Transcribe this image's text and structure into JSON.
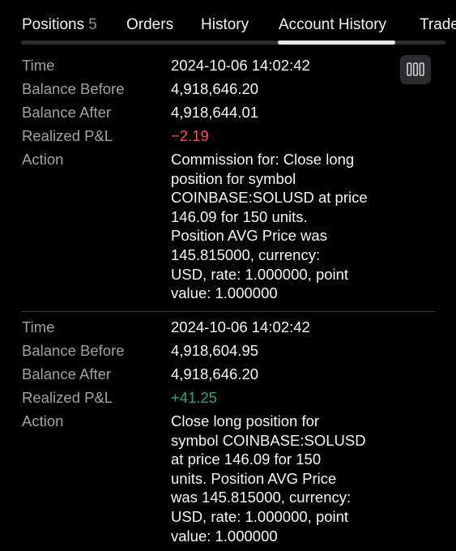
{
  "tabs": [
    {
      "label": "Positions",
      "count": "5"
    },
    {
      "label": "Orders"
    },
    {
      "label": "History"
    },
    {
      "label": "Account History",
      "active": true
    },
    {
      "label": "Trade"
    }
  ],
  "records": [
    {
      "time_label": "Time",
      "time": "2024-10-06 14:02:42",
      "balance_before_label": "Balance Before",
      "balance_before": "4,918,646.20",
      "balance_after_label": "Balance After",
      "balance_after": "4,918,644.01",
      "pnl_label": "Realized P&L",
      "pnl": "−2.19",
      "action_label": "Action",
      "action_lines": [
        "Commission for: Close long",
        "position for symbol",
        "COINBASE:SOLUSD at price",
        "146.09 for 150 units.",
        "Position AVG Price was",
        "145.815000, currency:",
        "USD, rate: 1.000000, point",
        "value: 1.000000"
      ]
    },
    {
      "time_label": "Time",
      "time": "2024-10-06 14:02:42",
      "balance_before_label": "Balance Before",
      "balance_before": "4,918,604.95",
      "balance_after_label": "Balance After",
      "balance_after": "4,918,646.20",
      "pnl_label": "Realized P&L",
      "pnl": "+41.25",
      "action_label": "Action",
      "action_lines": [
        "Close long position for",
        "symbol COINBASE:SOLUSD",
        "at price 146.09 for 150",
        "units. Position AVG Price",
        "was 145.815000, currency:",
        "USD, rate: 1.000000, point",
        "value: 1.000000"
      ]
    }
  ],
  "colors": {
    "background": "#000000",
    "negative": "#ff4d4f",
    "positive": "#26a97a",
    "label": "#a1a1a6"
  },
  "icons": {
    "columns_button": "columns-settings-icon"
  }
}
